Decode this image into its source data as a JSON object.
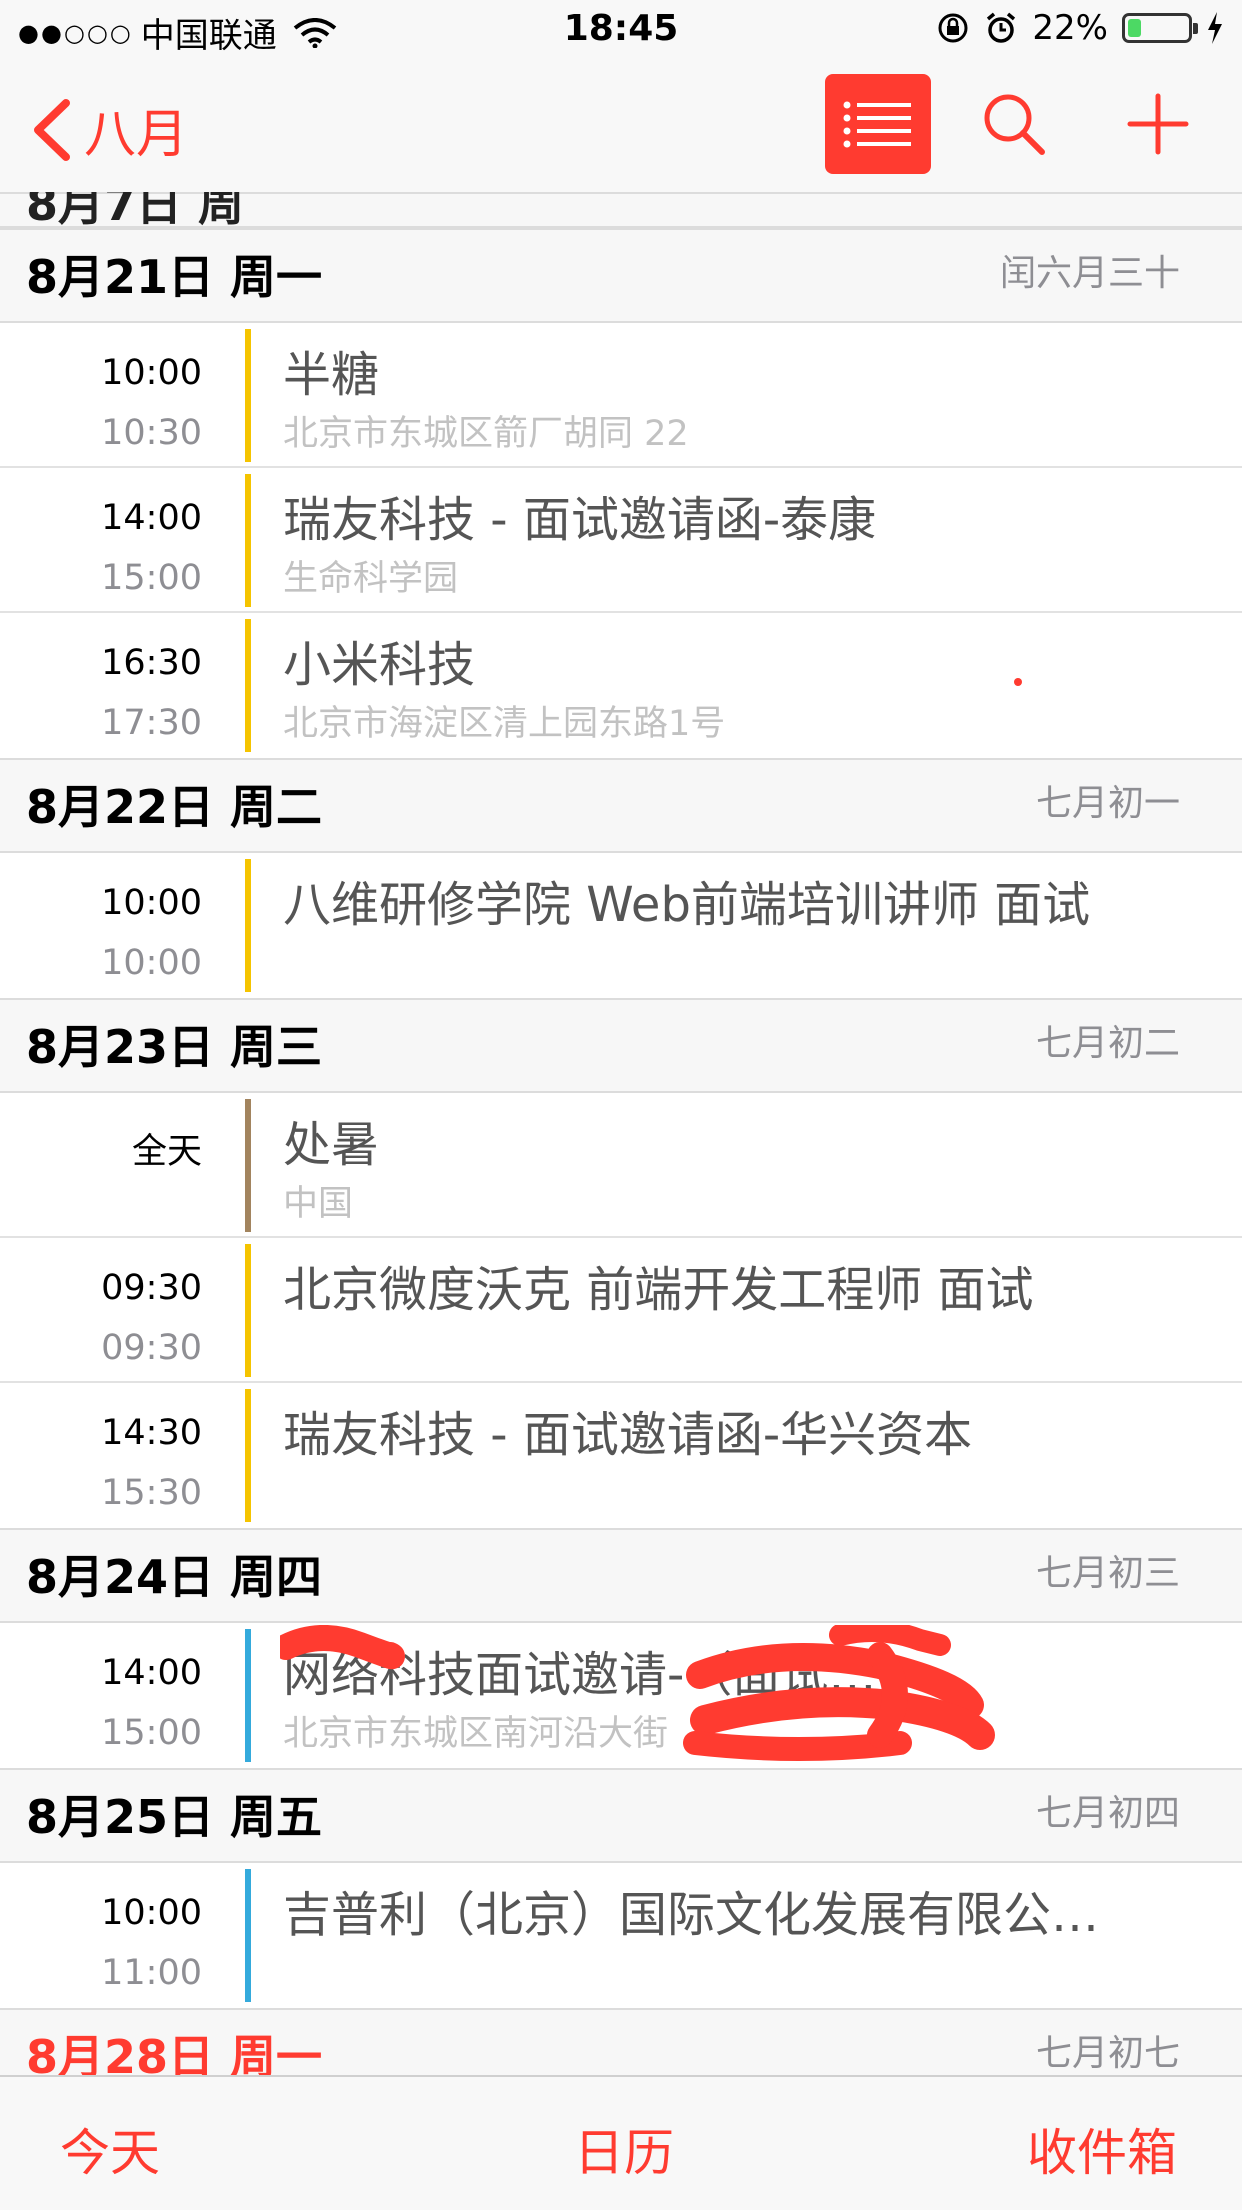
{
  "status_bar": {
    "signal": "●●○○○",
    "carrier": "中国联通",
    "time": "18:45",
    "battery_percent": "22%",
    "battery_level": 0.22,
    "icons": [
      "wifi-icon",
      "rotation-lock-icon",
      "alarm-icon",
      "battery-icon",
      "charging-icon"
    ]
  },
  "nav": {
    "back_label": "八月",
    "icons": [
      "list-view-icon",
      "search-icon",
      "add-icon"
    ]
  },
  "partial_header": {
    "date": "8月7日 周"
  },
  "sections": [
    {
      "date": "8月21日 周一",
      "lunar": "闰六月三十",
      "events": [
        {
          "start": "10:00",
          "end": "10:30",
          "title": "半糖",
          "location": "北京市东城区箭厂胡同 22",
          "color": "#f5c400"
        },
        {
          "start": "14:00",
          "end": "15:00",
          "title": "瑞友科技 - 面试邀请函-泰康",
          "location": "生命科学园",
          "color": "#f5c400"
        },
        {
          "start": "16:30",
          "end": "17:30",
          "title": "小米科技",
          "location": "北京市海淀区清上园东路1号",
          "color": "#f5c400"
        }
      ]
    },
    {
      "date": "8月22日 周二",
      "lunar": "七月初一",
      "events": [
        {
          "start": "10:00",
          "end": "10:00",
          "title": "八维研修学院 Web前端培训讲师 面试",
          "location": "",
          "color": "#f5c400"
        }
      ]
    },
    {
      "date": "8月23日 周三",
      "lunar": "七月初二",
      "events": [
        {
          "start": "全天",
          "end": "",
          "title": "处暑",
          "location": "中国",
          "color": "#a2845e"
        },
        {
          "start": "09:30",
          "end": "09:30",
          "title": "北京微度沃克 前端开发工程师 面试",
          "location": "",
          "color": "#f5c400"
        },
        {
          "start": "14:30",
          "end": "15:30",
          "title": "瑞友科技 - 面试邀请函-华兴资本",
          "location": "",
          "color": "#f5c400"
        }
      ]
    },
    {
      "date": "8月24日 周四",
      "lunar": "七月初三",
      "events": [
        {
          "start": "14:00",
          "end": "15:00",
          "title": "网络科技面试邀请-（面试…",
          "location": "北京市东城区南河沿大街",
          "color": "#34aadc"
        }
      ]
    },
    {
      "date": "8月25日 周五",
      "lunar": "七月初四",
      "events": [
        {
          "start": "10:00",
          "end": "11:00",
          "title": "吉普利（北京）国际文化发展有限公…",
          "location": "",
          "color": "#34aadc"
        }
      ]
    },
    {
      "date": "8月28日 周一",
      "lunar": "七月初七",
      "events": []
    }
  ],
  "tabs": {
    "today": "今天",
    "calendars": "日历",
    "inbox": "收件箱"
  },
  "colors": {
    "accent": "#ff3b30",
    "yellow": "#f5c400",
    "brown": "#a2845e",
    "blue": "#34aadc"
  }
}
